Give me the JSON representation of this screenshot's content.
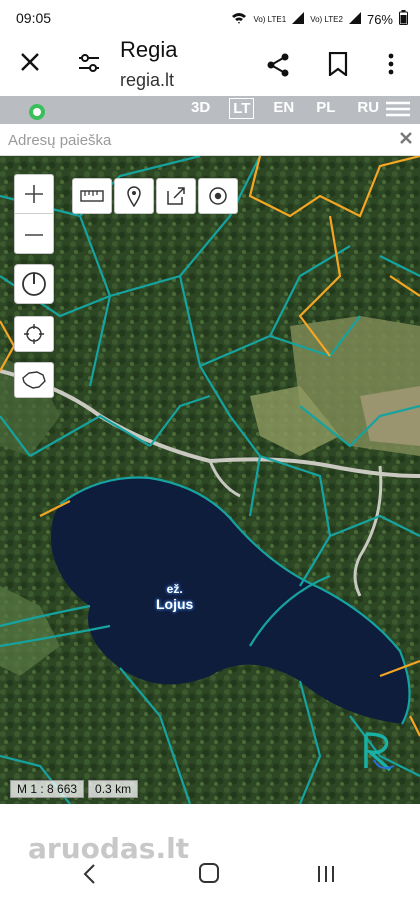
{
  "status_bar": {
    "time": "09:05",
    "battery": "76%",
    "signal1": "Vo) LTE1",
    "signal2": "Vo) LTE2"
  },
  "app_bar": {
    "title": "Regia",
    "url": "regia.lt"
  },
  "site_bar": {
    "links": [
      "3D",
      "LT",
      "EN",
      "PL",
      "RU"
    ],
    "active": "LT"
  },
  "search": {
    "placeholder": "Adresų paieška"
  },
  "map": {
    "lake_label_prefix": "ež.",
    "lake_label_name": "Lojus",
    "scale_text": "M 1 : 8 663",
    "distance_text": "0.3 km"
  },
  "footer": {
    "watermark": "aruodas.lt"
  },
  "colors": {
    "parcel_teal": "#16a3a0",
    "parcel_orange": "#f5a623",
    "lake": "#0f1d3d",
    "forest": "#2f4a26"
  }
}
